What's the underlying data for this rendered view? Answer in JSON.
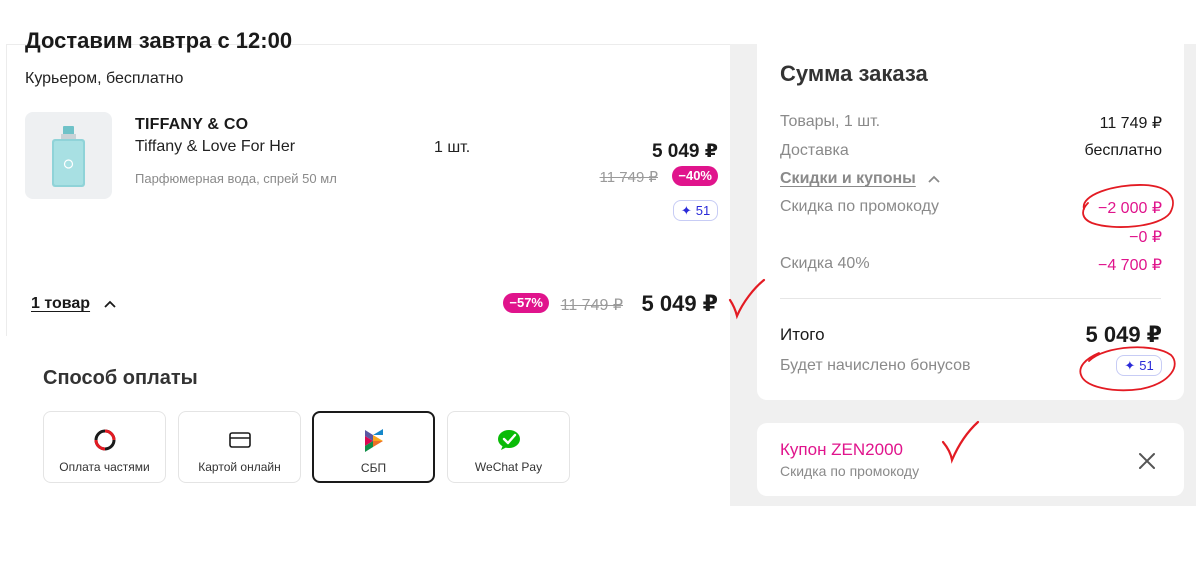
{
  "delivery": {
    "title": "Доставим завтра с 12:00",
    "subtitle": "Курьером, бесплатно",
    "product": {
      "brand": "TIFFANY & CO",
      "name": "Tiffany & Love For Her",
      "description": "Парфюмерная вода, спрей 50 мл",
      "quantity": "1 шт.",
      "price": "5 049 ₽",
      "old_price": "11 749 ₽",
      "discount": "−40%",
      "bonus": "51"
    },
    "items_toggle": "1 товар",
    "total_discount": "−57%",
    "total_old_price": "11 749 ₽",
    "total_price": "5 049 ₽"
  },
  "payment": {
    "title": "Способ оплаты",
    "options": [
      {
        "label": "Оплата частями",
        "icon": "installments-icon",
        "selected": false
      },
      {
        "label": "Картой онлайн",
        "icon": "card-icon",
        "selected": false
      },
      {
        "label": "СБП",
        "icon": "sbp-icon",
        "selected": true
      },
      {
        "label": "WeChat Pay",
        "icon": "wechat-icon",
        "selected": false
      }
    ]
  },
  "summary": {
    "title": "Сумма заказа",
    "goods_label": "Товары, 1 шт.",
    "goods_value": "11 749 ₽",
    "delivery_label": "Доставка",
    "delivery_value": "бесплатно",
    "discounts_toggle": "Скидки и купоны",
    "promo_label": "Скидка по промокоду",
    "promo_value": "−2 000 ₽",
    "promo_value_2": "−0 ₽",
    "discount40_label": "Скидка 40%",
    "discount40_value": "−4 700 ₽",
    "total_label": "Итого",
    "total_value": "5 049 ₽",
    "bonus_label": "Будет начислено бонусов",
    "bonus_value": "51"
  },
  "coupon": {
    "title": "Купон ZEN2000",
    "subtitle": "Скидка по промокоду"
  },
  "colors": {
    "accent_pink": "#e0148c",
    "bonus_blue": "#2a2ad8",
    "annotation_red": "#e31b23"
  }
}
